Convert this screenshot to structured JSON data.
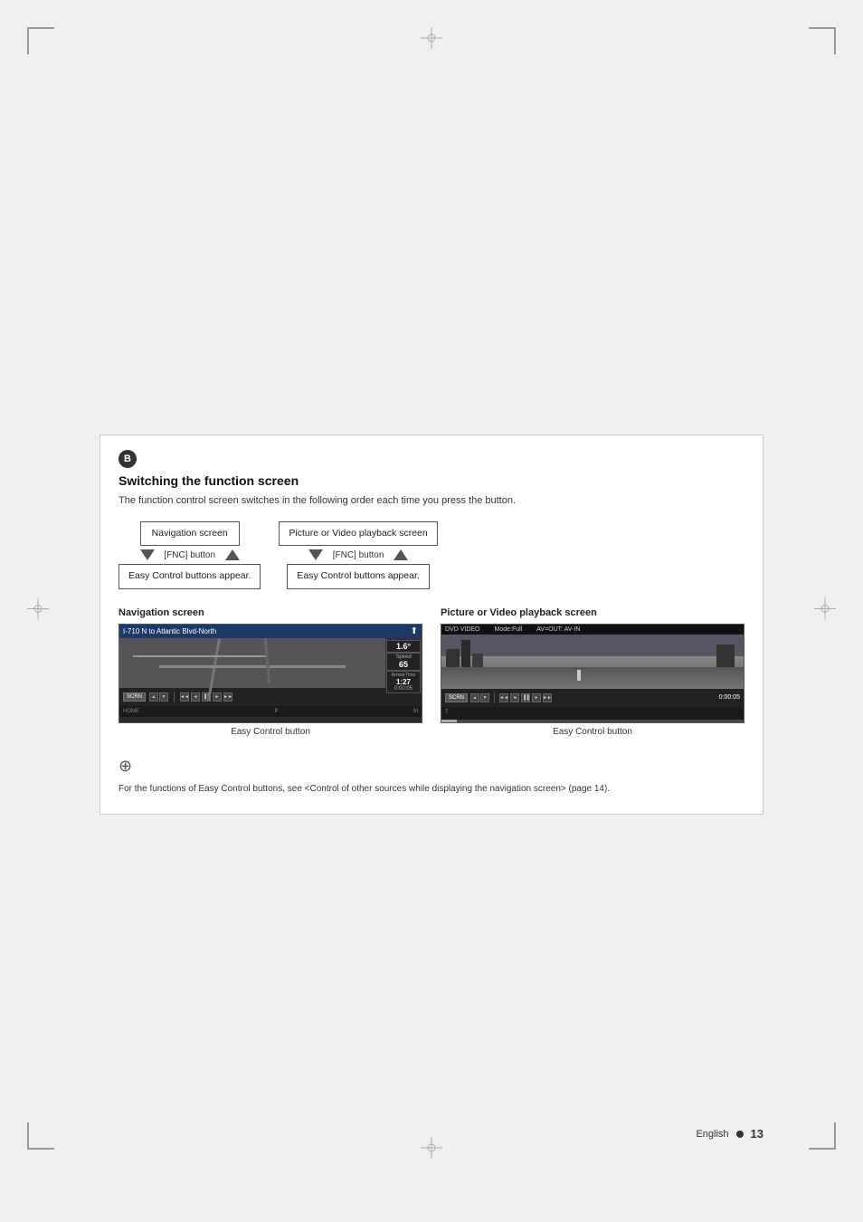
{
  "page": {
    "background_color": "#f0f0f0",
    "page_number": "13",
    "language": "English"
  },
  "section": {
    "badge": "B",
    "title": "Switching the function screen",
    "description": "The function control screen switches in the following order each time you press the button."
  },
  "flow_diagram": {
    "left_column": {
      "box": "Navigation screen",
      "arrow_down_label": "▼",
      "arrow_up_label": "▲",
      "fnc_label": "[FNC] button",
      "bottom_box": "Easy Control buttons appear."
    },
    "right_column": {
      "box": "Picture or Video playback screen",
      "arrow_down_label": "▼",
      "arrow_up_label": "▲",
      "fnc_label": "[FNC] button",
      "bottom_box": "Easy Control buttons appear."
    }
  },
  "screens": {
    "left": {
      "label": "Navigation screen",
      "top_bar_text": "I-710 N to Atlantic Blvd-North",
      "speed_label": "Speed",
      "speed_value": "65",
      "arrival_label": "Arrival Time",
      "arrival_value": "1:27",
      "distance_value": "1.6°",
      "time_display": "0:00:05",
      "scrn_button": "SCRN",
      "easy_control_label": "Easy Control button",
      "controls": [
        "◄◄",
        "◄",
        "▐▐",
        "►",
        "►►"
      ]
    },
    "right": {
      "label": "Picture or Video playback screen",
      "top_bar": {
        "dvd_video": "DVD VIDEO",
        "mode": "Mode:Full",
        "av": "AV=OUT: AV-IN"
      },
      "time_display": "0:00:05",
      "scrn_button": "SCRN",
      "easy_control_label": "Easy Control button",
      "controls": [
        "◄◄",
        "◄",
        "▐▐",
        "►",
        "►►"
      ]
    }
  },
  "note": {
    "icon": "⊕",
    "text": "For the functions of Easy Control buttons, see <Control of other sources while displaying the navigation screen> (page 14)."
  },
  "footer": {
    "language": "English",
    "page_number": "13"
  }
}
